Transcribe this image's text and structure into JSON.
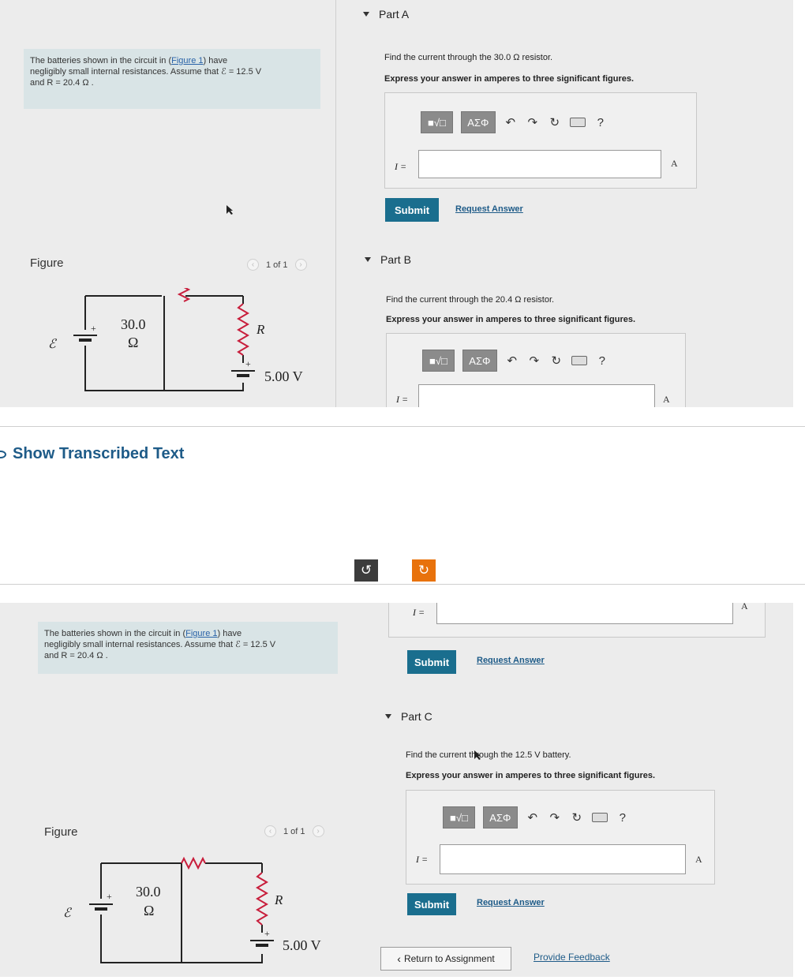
{
  "problem": {
    "text_l1_a": "The batteries shown in the circuit in (",
    "figure_link": "Figure 1",
    "text_l1_b": ") have",
    "text_l2": "negligibly small internal resistances. Assume that ℰ = 12.5 V",
    "text_l3": "and R = 20.4 Ω ."
  },
  "figure": {
    "label": "Figure",
    "pager": "1 of 1",
    "prev_icon": "chevron-left-icon",
    "next_icon": "chevron-right-icon",
    "emf_label": "ℰ",
    "resistor1_value": "30.0",
    "resistor1_unit": "Ω",
    "resistor2_label": "R",
    "battery2_value": "5.00 V",
    "plus_sign": "+"
  },
  "show_transcribed": "Show Transcribed Text",
  "part_a": {
    "header": "Part A",
    "question": "Find the current through the 30.0 Ω resistor.",
    "instruction": "Express your answer in amperes to three significant figures.",
    "input_label": "I =",
    "input_value": "",
    "unit": "A",
    "submit": "Submit",
    "request_answer": "Request Answer"
  },
  "part_b": {
    "header": "Part B",
    "question": "Find the current through the 20.4 Ω resistor.",
    "instruction": "Express your answer in amperes to three significant figures.",
    "input_label": "I =",
    "input_value": "",
    "unit": "A",
    "submit": "Submit",
    "request_answer": "Request Answer"
  },
  "part_c": {
    "header": "Part C",
    "question": "Find the current through the 12.5 V battery.",
    "instruction": "Express your answer in amperes to three significant figures.",
    "input_label": "I =",
    "input_value": "",
    "unit": "A",
    "submit": "Submit",
    "request_answer": "Request Answer"
  },
  "toolbar": {
    "templates_label": "■√□",
    "symbols_label": "ΑΣΦ",
    "undo_icon": "undo-icon",
    "redo_icon": "redo-icon",
    "reset_icon": "reset-icon",
    "keyboard_icon": "keyboard-icon",
    "help_label": "?"
  },
  "footer": {
    "return_label": "Return to Assignment",
    "feedback_label": "Provide Feedback"
  },
  "colors": {
    "submit_bg": "#1a6e8e",
    "link": "#1e5b88",
    "info_bg": "#d9e4e6",
    "refresh_orange": "#e8720c",
    "resistor_red": "#c81e3c"
  }
}
